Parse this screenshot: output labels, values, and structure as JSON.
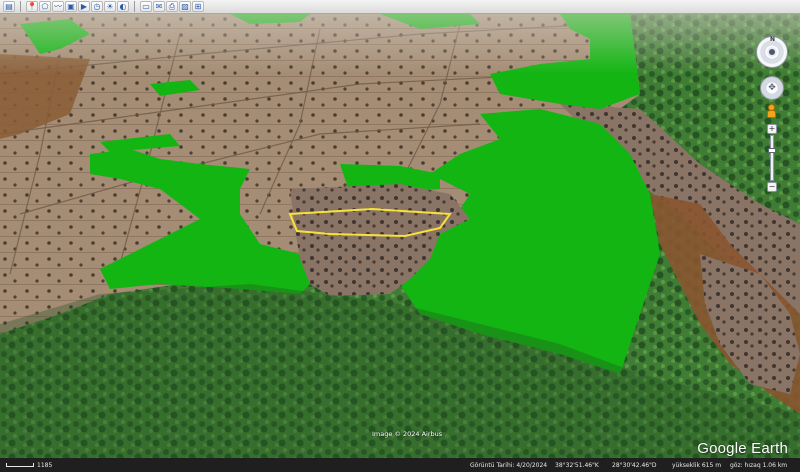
{
  "toolbar": {
    "buttons": [
      {
        "name": "sidebar-toggle-button",
        "icon": "sidebar-icon",
        "glyph": "▤"
      },
      {
        "name": "add-placemark-button",
        "icon": "pushpin-icon",
        "glyph": "📍"
      },
      {
        "name": "add-polygon-button",
        "icon": "polygon-icon",
        "glyph": "⬠"
      },
      {
        "name": "add-path-button",
        "icon": "path-icon",
        "glyph": "〰"
      },
      {
        "name": "add-image-overlay-button",
        "icon": "image-overlay-icon",
        "glyph": "▣"
      },
      {
        "name": "record-tour-button",
        "icon": "record-tour-icon",
        "glyph": "▶"
      },
      {
        "name": "historical-imagery-button",
        "icon": "clock-icon",
        "glyph": "◷"
      },
      {
        "name": "sunlight-button",
        "icon": "sun-icon",
        "glyph": "☀"
      },
      {
        "name": "planets-button",
        "icon": "planets-icon",
        "glyph": "◐"
      },
      {
        "name": "ruler-button",
        "icon": "ruler-icon",
        "glyph": "▭"
      },
      {
        "name": "email-button",
        "icon": "email-icon",
        "glyph": "✉"
      },
      {
        "name": "print-button",
        "icon": "print-icon",
        "glyph": "⎙"
      },
      {
        "name": "save-image-button",
        "icon": "save-image-icon",
        "glyph": "▨"
      },
      {
        "name": "view-in-maps-button",
        "icon": "maps-icon",
        "glyph": "⊞"
      }
    ]
  },
  "navigation": {
    "north_label": "N",
    "zoom_in_label": "+",
    "zoom_out_label": "−",
    "move_glyph": "✥",
    "zoom_level": 0.3
  },
  "overlay": {
    "imagery_credit": "Image © 2024 Airbus",
    "logo_text": "Google Earth"
  },
  "statusbar": {
    "scale_label": "1185",
    "imagery_date": "Görüntü Tarihi: 4/20/2024",
    "latitude": "38°32'51.46\"K",
    "longitude": "28°30'42.46\"D",
    "elevation": "yükseklik  615 m",
    "eye_altitude": "göz: hızaq  1.06 km"
  },
  "colors": {
    "forest_dark": "#2f6a2c",
    "forest_mid": "#4e8e3c",
    "highlight_green": "#12b512",
    "field_tan": "#a88e74",
    "field_brown": "#8c6a4a",
    "outline_yellow": "#f5e23a"
  }
}
